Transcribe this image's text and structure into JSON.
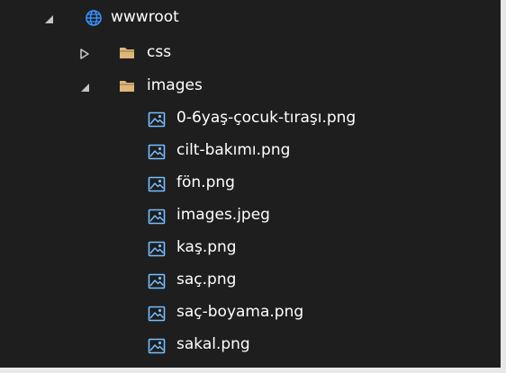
{
  "tree": {
    "root": {
      "label": "wwwroot",
      "expanded": true,
      "icon": "globe-icon"
    },
    "folders": [
      {
        "label": "css",
        "expanded": false,
        "icon": "folder-icon"
      },
      {
        "label": "images",
        "expanded": true,
        "icon": "folder-icon"
      }
    ],
    "files": [
      {
        "label": "0-6yaş-çocuk-tıraşı.png",
        "icon": "image-file-icon"
      },
      {
        "label": "cilt-bakımı.png",
        "icon": "image-file-icon"
      },
      {
        "label": "fön.png",
        "icon": "image-file-icon"
      },
      {
        "label": "images.jpeg",
        "icon": "image-file-icon"
      },
      {
        "label": "kaş.png",
        "icon": "image-file-icon"
      },
      {
        "label": "saç.png",
        "icon": "image-file-icon"
      },
      {
        "label": "saç-boyama.png",
        "icon": "image-file-icon"
      },
      {
        "label": "sakal.png",
        "icon": "image-file-icon"
      }
    ]
  },
  "colors": {
    "background": "#1e1e1e",
    "text": "#ffffff",
    "globe": "#3794ff",
    "folder": "#dcb67a",
    "image_icon": "#75beff",
    "toggle": "#c5c5c5"
  }
}
